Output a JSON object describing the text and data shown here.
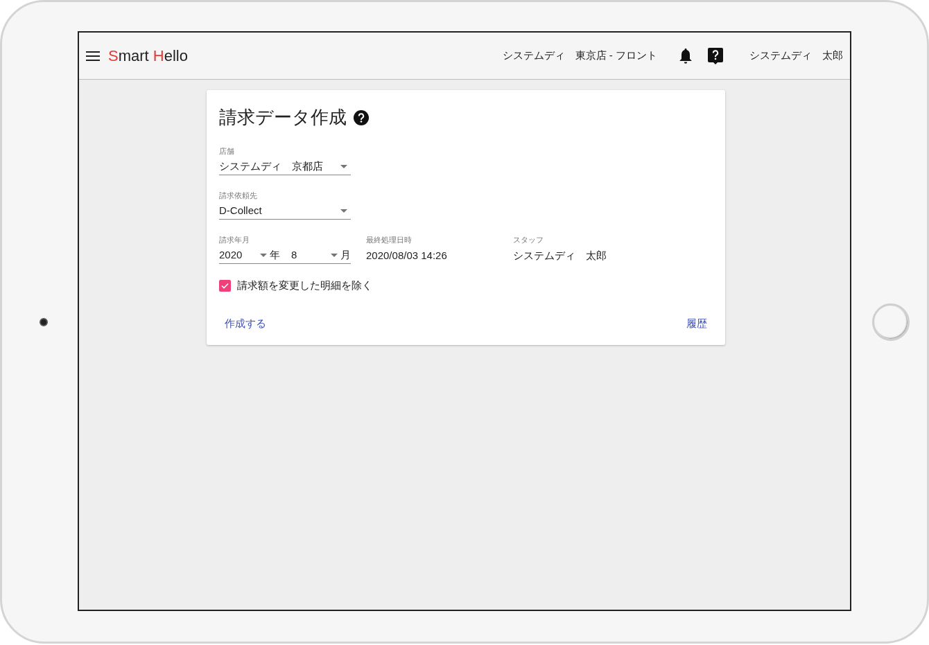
{
  "header": {
    "logo": [
      {
        "text": "S",
        "accent": true
      },
      {
        "text": "mart ",
        "accent": false
      },
      {
        "text": "H",
        "accent": true
      },
      {
        "text": "ello",
        "accent": false
      }
    ],
    "store": "システムディ　東京店 - フロント",
    "user": "システムディ　太郎"
  },
  "card": {
    "title": "請求データ作成",
    "fields": [
      {
        "label": "店舗",
        "value": "システムディ　京都店"
      },
      {
        "label": "請求依頼先",
        "value": "D-Collect"
      }
    ],
    "billing_month": {
      "label": "請求年月",
      "year": "2020",
      "year_unit": "年",
      "month": "8",
      "month_unit": "月"
    },
    "info": [
      {
        "label": "最終処理日時",
        "value": "2020/08/03 14:26"
      },
      {
        "label": "スタッフ",
        "value": "システムディ　太郎"
      }
    ],
    "checkbox": {
      "label": "請求額を変更した明細を除く",
      "checked": true
    },
    "actions": [
      {
        "label": "作成する"
      },
      {
        "label": "履歴"
      }
    ]
  }
}
